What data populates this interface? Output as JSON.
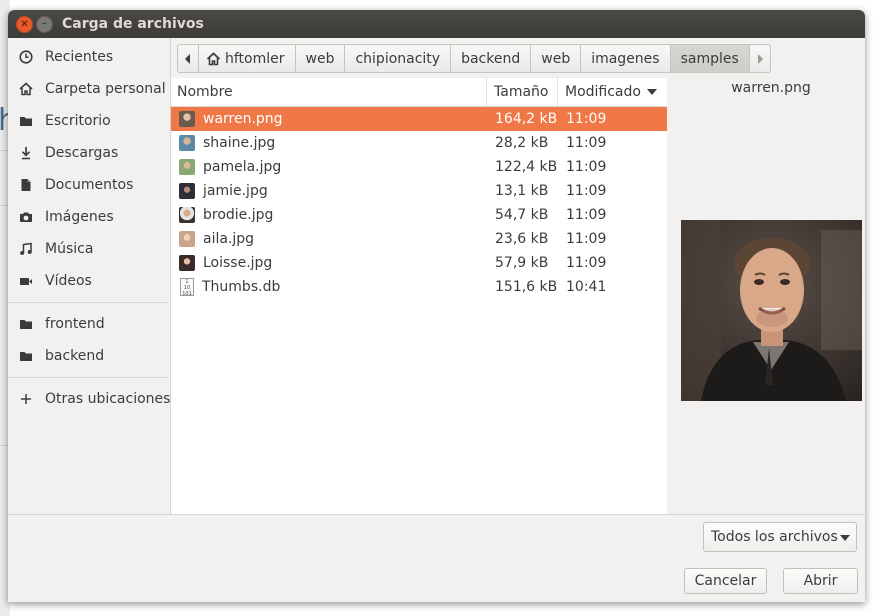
{
  "window": {
    "title": "Carga de archivos"
  },
  "sidebar": {
    "places": [
      {
        "label": "Recientes",
        "icon": "clock-icon"
      },
      {
        "label": "Carpeta personal",
        "icon": "home-icon"
      },
      {
        "label": "Escritorio",
        "icon": "folder-icon"
      },
      {
        "label": "Descargas",
        "icon": "download-icon"
      },
      {
        "label": "Documentos",
        "icon": "document-icon"
      },
      {
        "label": "Imágenes",
        "icon": "camera-icon"
      },
      {
        "label": "Música",
        "icon": "music-icon"
      },
      {
        "label": "Vídeos",
        "icon": "video-icon"
      }
    ],
    "bookmarks": [
      {
        "label": "frontend",
        "icon": "folder-icon"
      },
      {
        "label": "backend",
        "icon": "folder-icon"
      }
    ],
    "other": {
      "label": "Otras ubicaciones",
      "icon": "plus-icon"
    }
  },
  "pathbar": {
    "crumbs": [
      "hftomler",
      "web",
      "chipionacity",
      "backend",
      "web",
      "imagenes",
      "samples"
    ],
    "active_index": 6
  },
  "filelist": {
    "columns": {
      "name": "Nombre",
      "size": "Tamaño",
      "modified": "Modificado"
    },
    "sort_column": "modified",
    "rows": [
      {
        "name": "warren.png",
        "size": "164,2 kB",
        "modified": "11:09",
        "selected": true,
        "thumb_color": "#6b5a4e"
      },
      {
        "name": "shaine.jpg",
        "size": "28,2 kB",
        "modified": "11:09",
        "thumb_color": "#5a8aa8"
      },
      {
        "name": "pamela.jpg",
        "size": "122,4 kB",
        "modified": "11:09",
        "thumb_color": "#8aa870"
      },
      {
        "name": "jamie.jpg",
        "size": "13,1 kB",
        "modified": "11:09",
        "thumb_color": "#2e2e3a"
      },
      {
        "name": "brodie.jpg",
        "size": "54,7 kB",
        "modified": "11:09",
        "thumb_color": "#6a5a52"
      },
      {
        "name": "aila.jpg",
        "size": "23,6 kB",
        "modified": "11:09",
        "thumb_color": "#c8a48a"
      },
      {
        "name": "Loisse.jpg",
        "size": "57,9 kB",
        "modified": "11:09",
        "thumb_color": "#3a2a28"
      },
      {
        "name": "Thumbs.db",
        "size": "151,6 kB",
        "modified": "10:41",
        "thumb_color": ""
      }
    ]
  },
  "preview": {
    "filename": "warren.png"
  },
  "filter": {
    "label": "Todos los archivos"
  },
  "buttons": {
    "cancel": "Cancelar",
    "open": "Abrir"
  },
  "colors": {
    "selection": "#f07746",
    "close_button": "#e9592b"
  }
}
